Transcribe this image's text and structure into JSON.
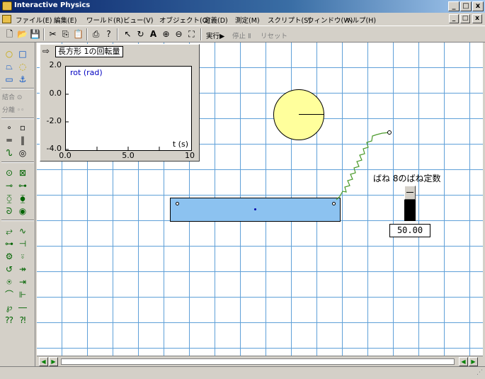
{
  "app": {
    "title": "Interactive Physics"
  },
  "window_controls": {
    "minimize": "_",
    "maximize": "□",
    "close": "x"
  },
  "menu": {
    "items": [
      "ファイル(E)",
      "編集(E)",
      "ワールド(R)",
      "ビュー(V)",
      "オブジェクト(O)",
      "定義(D)",
      "測定(M)",
      "スクリプト(S)",
      "ウィンドウ(W)",
      "ヘルプ(H)"
    ]
  },
  "toolbar": {
    "run_label": "実行▶",
    "stop_label": "停止 Ⅱ",
    "reset_label": "リセット"
  },
  "palette": {
    "join_label": "結合 ⊙",
    "split_label": "分離 ◦◦"
  },
  "graph": {
    "title": "長方形 1の回転量",
    "series": "rot (rad)",
    "axis_label": "t (s)",
    "y_ticks": [
      "2.0",
      "0.0",
      "-2.0",
      "-4.0"
    ],
    "x_ticks": [
      "0.0",
      "5.0",
      "10"
    ]
  },
  "slider": {
    "label": "ばね 8のばね定数",
    "value": "50.00"
  },
  "colors": {
    "grid": "#5fa0d8",
    "circle": "#ffff9c",
    "rect": "#8cc2f0",
    "spring": "#4a9a2a",
    "series": "#0000c0"
  }
}
